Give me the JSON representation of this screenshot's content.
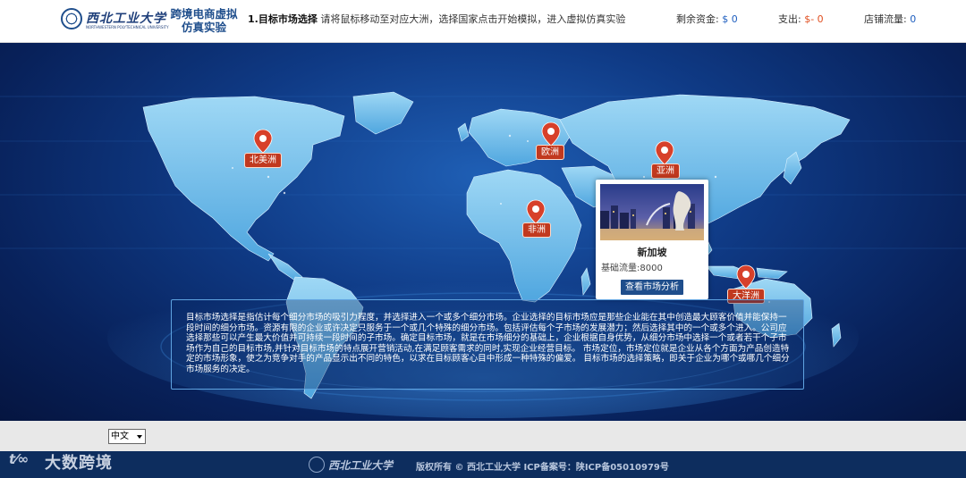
{
  "header": {
    "logo_text": "西北工业大学",
    "logo_sub": "NORTHWESTERN POLYTECHNICAL UNIVERSITY",
    "system_title_line1": "跨境电商虚拟",
    "system_title_line2": "仿真实验",
    "step_label": "1.目标市场选择",
    "step_instruction": "请将鼠标移动至对应大洲，选择国家点击开始模拟，进入虚拟仿真实验",
    "funds_label": "剩余资金:",
    "funds_value": "$ 0",
    "expense_label": "支出:",
    "expense_value": "$- 0",
    "traffic_label": "店铺流量:",
    "traffic_value": "0"
  },
  "map": {
    "continents": [
      {
        "id": "north-america",
        "label": "北美洲"
      },
      {
        "id": "europe",
        "label": "欧洲"
      },
      {
        "id": "asia",
        "label": "亚洲"
      },
      {
        "id": "africa",
        "label": "非洲"
      },
      {
        "id": "oceania",
        "label": "大洋洲"
      }
    ],
    "popup": {
      "city": "新加坡",
      "base_traffic": "基础流量:8000",
      "button_label": "查看市场分析"
    }
  },
  "description": "目标市场选择是指估计每个细分市场的吸引力程度，并选择进入一个或多个细分市场。企业选择的目标市场应是那些企业能在其中创造最大顾客价值并能保持一段时间的细分市场。资源有限的企业或许决定只服务于一个或几个特殊的细分市场。包括评估每个子市场的发展潜力；然后选择其中的一个或多个进入。公司应选择那些可以产生最大价值并可持续一段时间的子市场。确定目标市场，就是在市场细分的基础上，企业根据自身优势，从细分市场中选择一个或者若干个子市场作为自己的目标市场,并针对目标市场的特点展开营销活动,在满足顾客需求的同时,实现企业经营目标。 市场定位，市场定位就是企业从各个方面为产品创造特定的市场形象，使之为竞争对手的产品显示出不同的特色，以求在目标顾客心目中形成一种特殊的偏爱。 目标市场的选择策略，即关于企业为哪个或哪几个细分市场服务的决定。",
  "language": {
    "selected": "中文"
  },
  "footer": {
    "logo_text": "西北工业大学",
    "copyright": "版权所有 © 西北工业大学 ICP备案号：陕ICP备05010979号"
  },
  "watermark": {
    "mark": "t⁄∞",
    "text": "大数跨境"
  },
  "colors": {
    "header_blue": "#1f4e8c",
    "label_red": "#c1391f",
    "footer_bg": "#0d2d5e"
  }
}
